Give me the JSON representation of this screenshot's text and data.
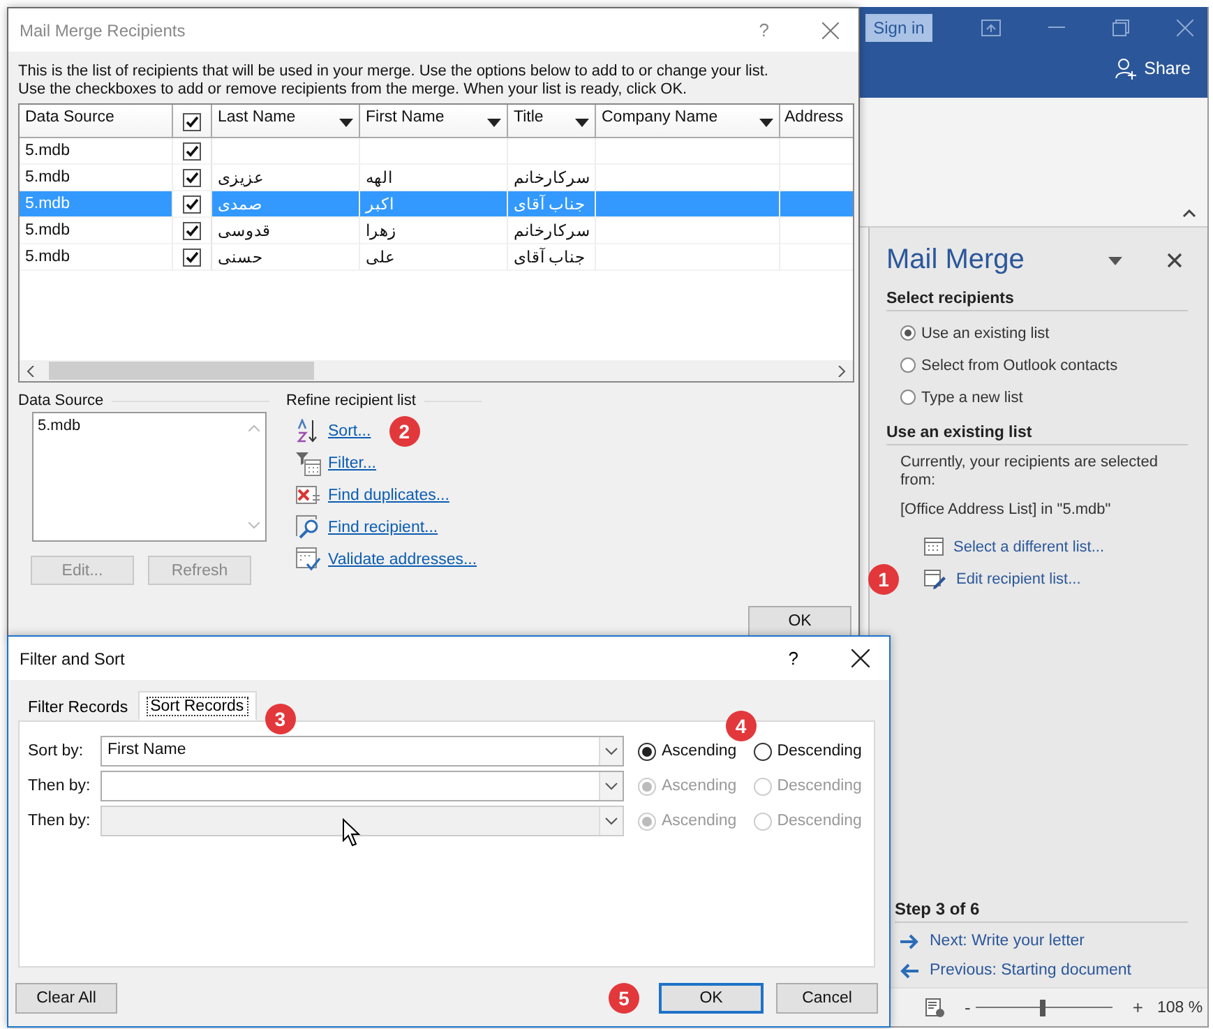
{
  "word_window": {
    "sign_in": "Sign in",
    "share": "Share",
    "task_pane": {
      "title": "Mail Merge",
      "select_heading": "Select recipients",
      "recipient_options": [
        {
          "label": "Use an existing list",
          "selected": true
        },
        {
          "label": "Select from Outlook contacts",
          "selected": false
        },
        {
          "label": "Type a new list",
          "selected": false
        }
      ],
      "list_heading": "Use an existing list",
      "description": "Currently, your recipients are selected from:",
      "source": "[Office Address List] in \"5.mdb\"",
      "actions": [
        {
          "kind": "select",
          "label": "Select a different list..."
        },
        {
          "kind": "edit",
          "label": "Edit recipient list...",
          "marker": "1"
        }
      ],
      "step": "Step 3 of 6",
      "navigation": [
        {
          "kind": "next",
          "label": "Next: Write your letter"
        },
        {
          "kind": "previous",
          "label": "Previous: Starting document"
        }
      ]
    },
    "status_bar": {
      "zoom_out": "-",
      "zoom_in": "+",
      "zoom": {
        "level": 0.49
      },
      "zoom_reading": "108 %"
    }
  },
  "recipients_dialog": {
    "title": "Mail Merge Recipients",
    "help": "?",
    "intro": [
      "This is the list of recipients that will be used in your merge.  Use the options below to add to or change your list.",
      "Use the checkboxes to add or remove recipients from the merge.  When your list is ready, click OK."
    ],
    "table": {
      "columns": [
        {
          "kind": "text",
          "label": "Data Source",
          "filter": false
        },
        {
          "kind": "check",
          "checked": true
        },
        {
          "kind": "text",
          "label": "Last Name",
          "filter": true
        },
        {
          "kind": "text",
          "label": "First Name",
          "filter": true
        },
        {
          "kind": "text",
          "label": "Title",
          "filter": true
        },
        {
          "kind": "text",
          "label": "Company Name",
          "filter": true
        },
        {
          "kind": "text",
          "label": "Address",
          "filter": false
        }
      ],
      "rows": [
        {
          "data_source": "5.mdb",
          "checked": true,
          "selected": false
        },
        {
          "data_source": "5.mdb",
          "checked": true,
          "selected": false,
          "last_name": "عزیزی",
          "first_name": "الهه",
          "title": "سرکارخانم"
        },
        {
          "data_source": "5.mdb",
          "checked": true,
          "selected": true,
          "last_name": "صمدی",
          "first_name": "اکبر",
          "title": "جناب آقای"
        },
        {
          "data_source": "5.mdb",
          "checked": true,
          "selected": false,
          "last_name": "قدوسی",
          "first_name": "زهرا",
          "title": "سرکارخانم"
        },
        {
          "data_source": "5.mdb",
          "checked": true,
          "selected": false,
          "last_name": "حسنی",
          "first_name": "علی",
          "title": "جناب آقای"
        }
      ]
    },
    "data_source_label": "Data Source",
    "data_sources": [
      "5.mdb"
    ],
    "buttons": [
      {
        "label": "Edit...",
        "disabled": true
      },
      {
        "label": "Refresh",
        "disabled": true
      }
    ],
    "refine_label": "Refine recipient list",
    "refine_links": [
      {
        "kind": "sort",
        "label": "Sort...",
        "marker": "2"
      },
      {
        "kind": "filter",
        "label": "Filter..."
      },
      {
        "kind": "duplicates",
        "label": "Find duplicates..."
      },
      {
        "kind": "find",
        "label": "Find recipient..."
      },
      {
        "kind": "validate",
        "label": "Validate addresses..."
      }
    ],
    "ok": "OK"
  },
  "sort_dialog": {
    "title": "Filter and Sort",
    "help": "?",
    "tabs": [
      {
        "label": "Filter Records",
        "selected": false
      },
      {
        "label": "Sort Records",
        "selected": true,
        "marker": "3"
      }
    ],
    "sort_rows": [
      {
        "label": "Sort by:",
        "value": "First Name",
        "disabled": false,
        "order_disabled": false,
        "order": [
          {
            "label": "Ascending",
            "selected": true,
            "marker": "4"
          },
          {
            "label": "Descending",
            "selected": false
          }
        ]
      },
      {
        "label": "Then by:",
        "disabled": false,
        "order_disabled": true,
        "order": [
          {
            "label": "Ascending",
            "selected": true
          },
          {
            "label": "Descending",
            "selected": false
          }
        ]
      },
      {
        "label": "Then by:",
        "disabled": true,
        "order_disabled": true,
        "order": [
          {
            "label": "Ascending",
            "selected": true
          },
          {
            "label": "Descending",
            "selected": false
          }
        ]
      }
    ],
    "buttons": [
      {
        "label": "Clear All",
        "kind": "secondary"
      },
      {
        "label": "OK",
        "kind": "default",
        "marker": "5"
      },
      {
        "label": "Cancel",
        "kind": "secondary"
      }
    ]
  }
}
